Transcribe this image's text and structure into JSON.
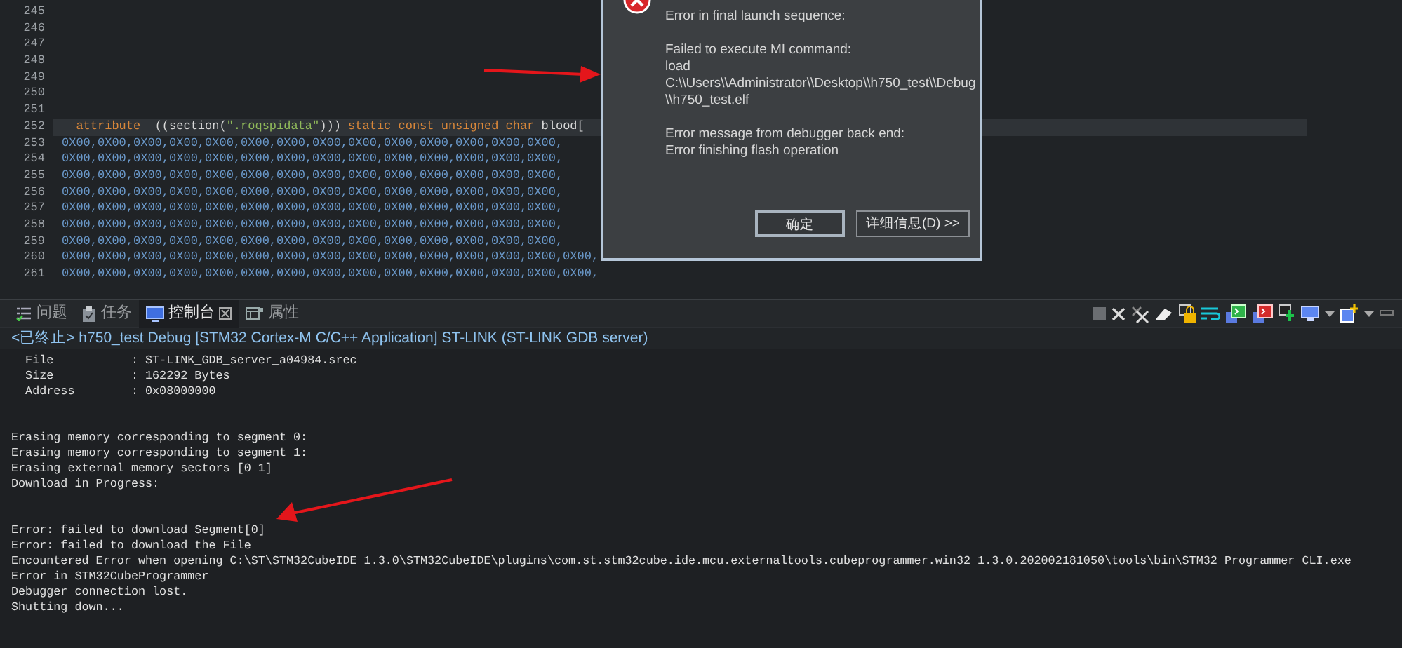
{
  "editor": {
    "lines": [
      {
        "number": "245",
        "current": false
      },
      {
        "number": "246",
        "current": false
      },
      {
        "number": "247",
        "current": false
      },
      {
        "number": "248",
        "current": false
      },
      {
        "number": "249",
        "current": false
      },
      {
        "number": "250",
        "current": false
      },
      {
        "number": "251",
        "current": false
      },
      {
        "number": "252",
        "current": true,
        "tokens": [
          {
            "kind": "keyword",
            "text": "__attribute__"
          },
          {
            "kind": "plain",
            "text": "((section("
          },
          {
            "kind": "string",
            "text": "\".roqspidata\""
          },
          {
            "kind": "plain",
            "text": "))) "
          },
          {
            "kind": "keyword",
            "text": "static const unsigned char"
          },
          {
            "kind": "plain",
            "text": " blood["
          }
        ]
      },
      {
        "number": "253",
        "current": false,
        "tokens": [
          {
            "kind": "number",
            "text": "0X00,0X00,0X00,0X00,0X00,0X00,0X00,0X00,0X00,0X00,0X00,0X00,0X00,0X00,"
          }
        ]
      },
      {
        "number": "254",
        "current": false,
        "tokens": [
          {
            "kind": "number",
            "text": "0X00,0X00,0X00,0X00,0X00,0X00,0X00,0X00,0X00,0X00,0X00,0X00,0X00,0X00,"
          }
        ]
      },
      {
        "number": "255",
        "current": false,
        "tokens": [
          {
            "kind": "number",
            "text": "0X00,0X00,0X00,0X00,0X00,0X00,0X00,0X00,0X00,0X00,0X00,0X00,0X00,0X00,"
          }
        ]
      },
      {
        "number": "256",
        "current": false,
        "tokens": [
          {
            "kind": "number",
            "text": "0X00,0X00,0X00,0X00,0X00,0X00,0X00,0X00,0X00,0X00,0X00,0X00,0X00,0X00,"
          }
        ]
      },
      {
        "number": "257",
        "current": false,
        "tokens": [
          {
            "kind": "number",
            "text": "0X00,0X00,0X00,0X00,0X00,0X00,0X00,0X00,0X00,0X00,0X00,0X00,0X00,0X00,"
          }
        ]
      },
      {
        "number": "258",
        "current": false,
        "tokens": [
          {
            "kind": "number",
            "text": "0X00,0X00,0X00,0X00,0X00,0X00,0X00,0X00,0X00,0X00,0X00,0X00,0X00,0X00,"
          }
        ]
      },
      {
        "number": "259",
        "current": false,
        "tokens": [
          {
            "kind": "number",
            "text": "0X00,0X00,0X00,0X00,0X00,0X00,0X00,0X00,0X00,0X00,0X00,0X00,0X00,0X00,"
          }
        ]
      },
      {
        "number": "260",
        "current": false,
        "tokens": [
          {
            "kind": "number",
            "text": "0X00,0X00,0X00,0X00,0X00,0X00,0X00,0X00,0X00,0X00,0X00,0X00,0X00,0X00,0X00,"
          }
        ]
      },
      {
        "number": "261",
        "current": false,
        "tokens": [
          {
            "kind": "number",
            "text": "0X00,0X00,0X00,0X00,0X00,0X00,0X00,0X00,0X00,0X00,0X00,0X00,0X00,0X00,0X00,"
          }
        ]
      }
    ]
  },
  "dialog": {
    "paragraphs": [
      [
        "Error in final launch sequence:"
      ],
      [
        "Failed to execute MI command:",
        "load",
        "C:\\\\Users\\\\Administrator\\\\Desktop\\\\h750_test\\\\Debug\\\\h750_test.elf"
      ],
      [
        "Error message from debugger back end:",
        "Error finishing flash operation"
      ]
    ],
    "buttons": [
      {
        "label": "确定",
        "default": true
      },
      {
        "label": "详细信息(D) >>",
        "default": false
      }
    ]
  },
  "panel": {
    "tabs": [
      {
        "label": "问题",
        "selected": false
      },
      {
        "label": "任务",
        "selected": false
      },
      {
        "label": "控制台",
        "selected": true
      },
      {
        "label": "属性",
        "selected": false
      }
    ],
    "status": "<已终止> h750_test Debug [STM32 Cortex-M C/C++ Application] ST-LINK (ST-LINK GDB server)",
    "console_blocks": [
      [
        "  File           : ST-LINK_GDB_server_a04984.srec",
        "  Size           : 162292 Bytes",
        "  Address        : 0x08000000"
      ],
      [
        "Erasing memory corresponding to segment 0:",
        "Erasing memory corresponding to segment 1:",
        "Erasing external memory sectors [0 1]",
        "Download in Progress:"
      ],
      [
        "Error: failed to download Segment[0]",
        "Error: failed to download the File",
        "Encountered Error when opening C:\\ST\\STM32CubeIDE_1.3.0\\STM32CubeIDE\\plugins\\com.st.stm32cube.ide.mcu.externaltools.cubeprogrammer.win32_1.3.0.202002181050\\tools\\bin\\STM32_Programmer_CLI.exe",
        "Error in STM32CubeProgrammer",
        "Debugger connection lost.",
        "Shutting down..."
      ]
    ]
  }
}
